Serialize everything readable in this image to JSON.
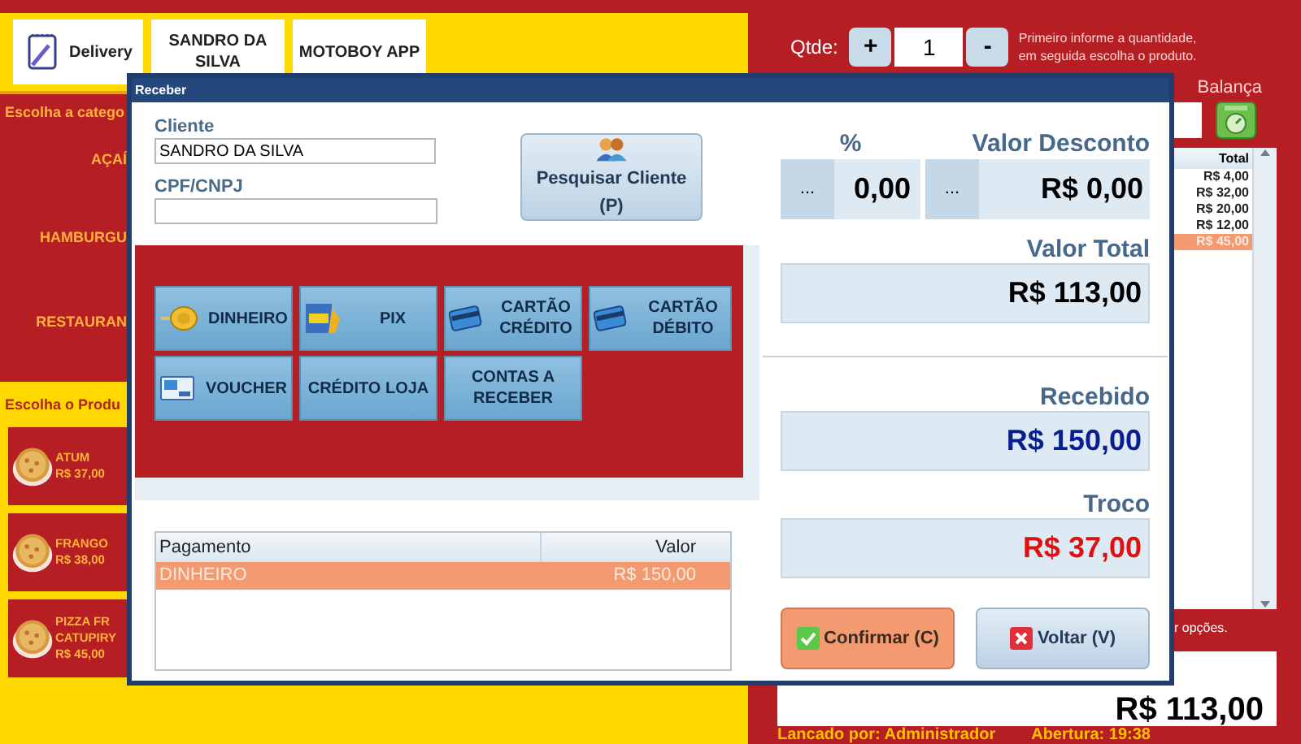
{
  "app": {
    "top_tabs": [
      {
        "label": "Delivery",
        "kind": "notepad"
      },
      {
        "label": "SANDRO DA SILVA",
        "kind": "plain"
      },
      {
        "label": "MOTOBOY APP",
        "kind": "plain"
      }
    ],
    "category_heading": "Escolha a catego",
    "categories": [
      "AÇAÍ",
      "HAMBURGU",
      "RESTAURAN"
    ],
    "product_heading": "Escolha o Produ",
    "products": [
      {
        "name_lines": [
          "ATUM"
        ],
        "price": "R$ 37,00"
      },
      {
        "name_lines": [
          "FRANGO"
        ],
        "price": "R$ 38,00"
      },
      {
        "name_lines": [
          "PIZZA FR",
          "CATUPIRY"
        ],
        "price": "R$ 45,00"
      }
    ],
    "quantity": {
      "label": "Qtde:",
      "plus": "+",
      "value": "1",
      "minus": "-",
      "hint_lines": [
        "Primeiro informe a quantidade,",
        "em seguida escolha o produto."
      ]
    },
    "scale_label": "Balança",
    "items_table": {
      "column": "Total",
      "rows": [
        {
          "value": "R$ 4,00",
          "selected": false
        },
        {
          "value": "R$ 32,00",
          "selected": false
        },
        {
          "value": "R$ 20,00",
          "selected": false
        },
        {
          "value": "R$ 12,00",
          "selected": false
        },
        {
          "value": "R$ 45,00",
          "selected": true
        }
      ]
    },
    "options_hint": "r opções.",
    "total": "R$ 113,00",
    "footer": {
      "launched_by": "Lancado por: Administrador",
      "opened": "Abertura: 19:38"
    }
  },
  "dialog": {
    "title": "Receber",
    "client": {
      "label": "Cliente",
      "value": "SANDRO DA SILVA"
    },
    "document": {
      "label": "CPF/CNPJ"
    },
    "search_button": "Pesquisar Cliente (P)",
    "payment_methods": [
      {
        "label": "DINHEIRO",
        "kind": "coin"
      },
      {
        "label": "PIX",
        "kind": "pix"
      },
      {
        "label": "CARTÃO CRÉDITO",
        "kind": "card"
      },
      {
        "label": "CARTÃO DÉBITO",
        "kind": "card"
      },
      {
        "label": "VOUCHER",
        "kind": "voucher"
      },
      {
        "label": "CRÉDITO LOJA",
        "kind": "plain"
      },
      {
        "label": "CONTAS A RECEBER",
        "kind": "plain"
      }
    ],
    "payments": {
      "columns": [
        "Pagamento",
        "Valor"
      ],
      "rows": [
        {
          "method": "DINHEIRO",
          "value": "R$ 150,00",
          "selected": true
        }
      ]
    },
    "discount_percent": {
      "label": "%",
      "button": "...",
      "value": "0,00"
    },
    "discount_value": {
      "label": "Valor Desconto",
      "button": "...",
      "value": "R$ 0,00"
    },
    "total": {
      "label": "Valor Total",
      "value": "R$ 113,00"
    },
    "received": {
      "label": "Recebido",
      "value": "R$ 150,00"
    },
    "change": {
      "label": "Troco",
      "value": "R$ 37,00"
    },
    "confirm_button": "Confirmar (C)",
    "back_button": "Voltar (V)"
  }
}
